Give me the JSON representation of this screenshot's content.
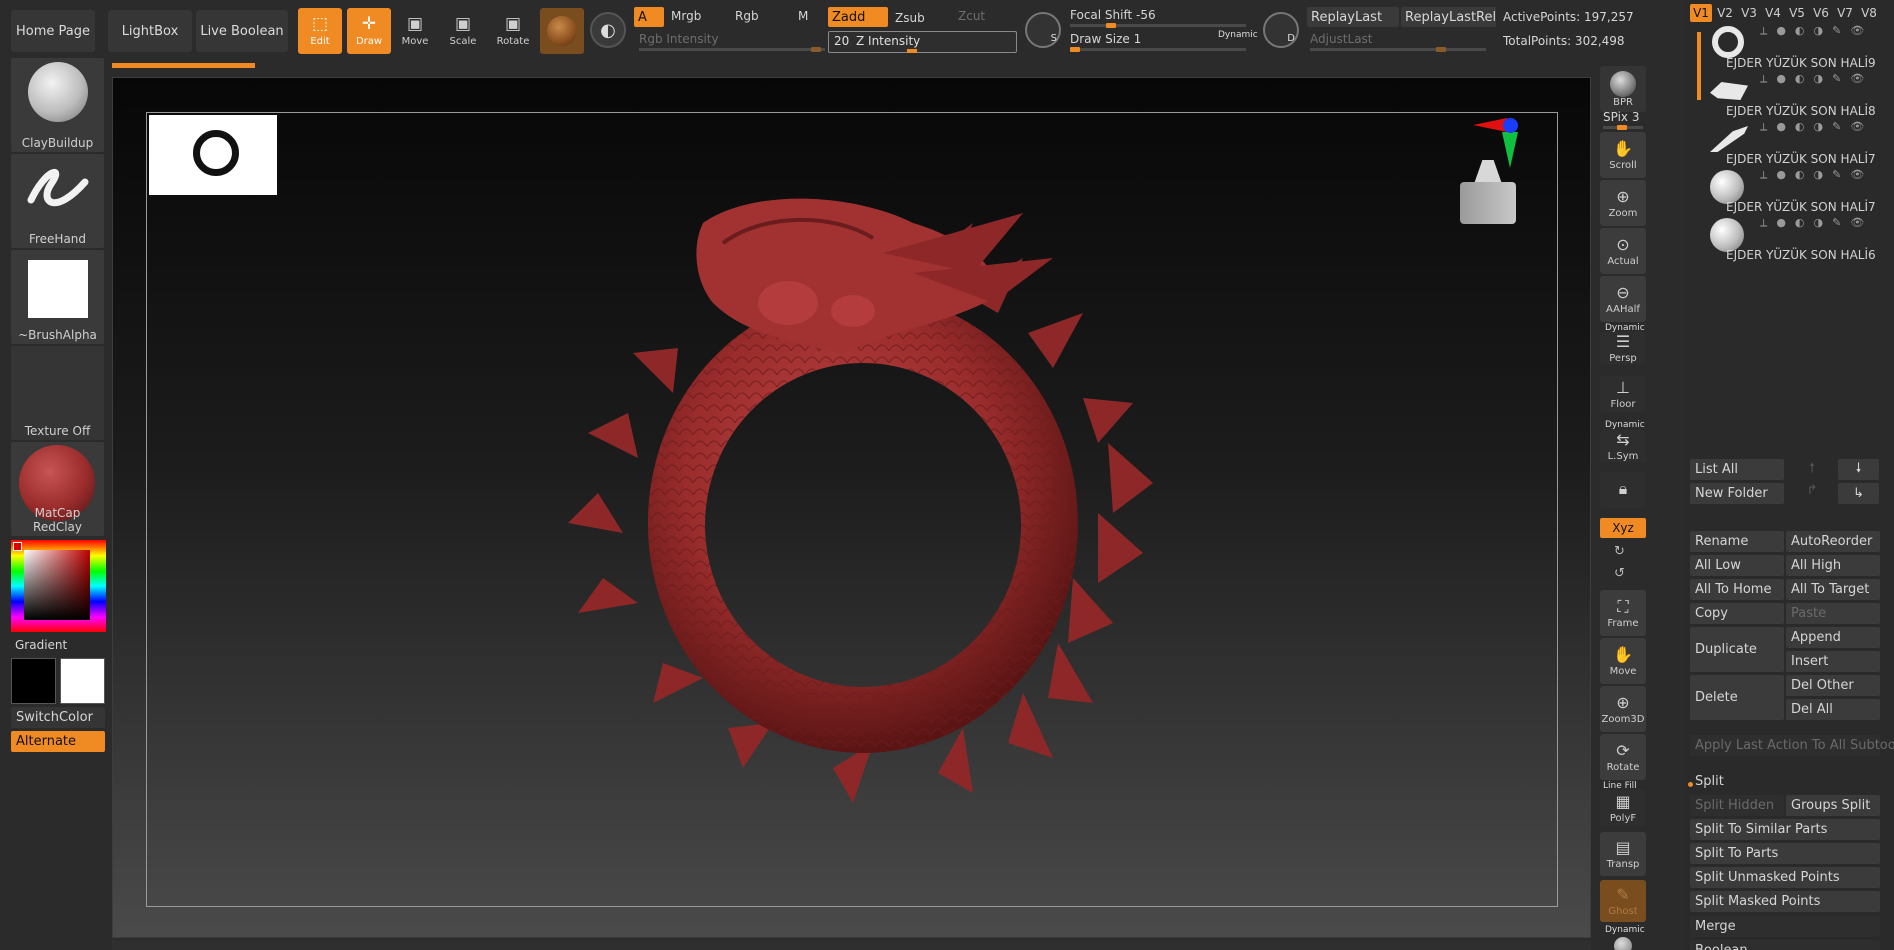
{
  "top": {
    "home_page": "Home Page",
    "lightbox": "LightBox",
    "live_boolean": "Live Boolean",
    "edit": "Edit",
    "draw": "Draw",
    "move": "Move",
    "scale": "Scale",
    "rotate": "Rotate",
    "a_label": "A",
    "mrgb": "Mrgb",
    "rgb": "Rgb",
    "m": "M",
    "zadd": "Zadd",
    "zsub": "Zsub",
    "zcut": "Zcut",
    "rgb_intensity": "Rgb Intensity",
    "z_intensity_value": "20",
    "z_intensity_label": "Z Intensity",
    "focal_shift": "Focal Shift -56",
    "draw_size": "Draw Size 1",
    "dynamic": "Dynamic",
    "replay_last": "ReplayLast",
    "replay_last_rel": "ReplayLastRel",
    "adjust_last": "AdjustLast",
    "active_points": "ActivePoints: 197,257",
    "total_points": "TotalPoints: 302,498",
    "s_label": "S",
    "d_label": "D"
  },
  "left": {
    "brush": "ClayBuildup",
    "stroke": "FreeHand",
    "alpha": "~BrushAlpha",
    "texture": "Texture Off",
    "material": "MatCap RedClay",
    "gradient": "Gradient",
    "switch_color": "SwitchColor",
    "alternate": "Alternate"
  },
  "right_shelf": {
    "bpr": "BPR",
    "spix": "SPix 3",
    "scroll": "Scroll",
    "zoom": "Zoom",
    "actual": "Actual",
    "aahalf": "AAHalf",
    "dynamic": "Dynamic",
    "persp": "Persp",
    "floor": "Floor",
    "lsym_dynamic": "Dynamic",
    "lsym": "L.Sym",
    "xyz": "Xyz",
    "frame": "Frame",
    "move": "Move",
    "zoom3d": "Zoom3D",
    "rotate": "Rotate",
    "line_fill": "Line Fill",
    "polyf": "PolyF",
    "transp": "Transp",
    "ghost": "Ghost",
    "dynamic2": "Dynamic"
  },
  "panel": {
    "tabs": [
      "V1",
      "V2",
      "V3",
      "V4",
      "V5",
      "V6",
      "V7",
      "V8"
    ],
    "subtools": [
      {
        "name": "EJDER YÜZÜK SON HALİ9",
        "thumb": "ring"
      },
      {
        "name": "EJDER YÜZÜK SON HALİ8",
        "thumb": "dragon-head"
      },
      {
        "name": "EJDER YÜZÜK SON HALİ7",
        "thumb": "tail"
      },
      {
        "name": "EJDER YÜZÜK SON HALİ7",
        "thumb": "sphere"
      },
      {
        "name": "EJDER YÜZÜK SON HALİ6",
        "thumb": "sphere"
      }
    ],
    "list_all": "List All",
    "new_folder": "New Folder",
    "rename": "Rename",
    "auto_reorder": "AutoReorder",
    "all_low": "All Low",
    "all_high": "All High",
    "all_to_home": "All To Home",
    "all_to_target": "All To Target",
    "copy": "Copy",
    "paste": "Paste",
    "duplicate": "Duplicate",
    "append": "Append",
    "insert": "Insert",
    "delete": "Delete",
    "del_other": "Del Other",
    "del_all": "Del All",
    "apply_last": "Apply Last Action To All Subtools",
    "split": "Split",
    "split_hidden": "Split Hidden",
    "groups_split": "Groups Split",
    "split_similar": "Split To Similar Parts",
    "split_parts": "Split To Parts",
    "split_unmasked": "Split Unmasked Points",
    "split_masked": "Split Masked Points",
    "merge": "Merge",
    "boolean": "Boolean"
  },
  "colors": {
    "accent": "#f08a22",
    "model": "#9a2c2c"
  }
}
